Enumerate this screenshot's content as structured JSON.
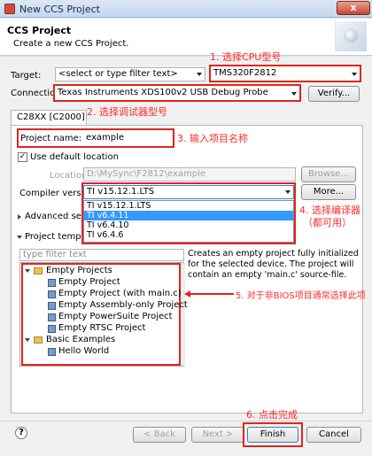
{
  "window": {
    "title": "New CCS Project",
    "close_label": "x"
  },
  "header": {
    "title": "CCS Project",
    "subtitle": "Create a new CCS Project."
  },
  "target": {
    "label": "Target:",
    "filter_value": "<select or type filter text>",
    "device_value": "TMS320F2812"
  },
  "connection": {
    "label": "Connection:",
    "value": "Texas Instruments XDS100v2 USB Debug Probe",
    "verify_label": "Verify..."
  },
  "tab": {
    "label": "C28XX [C2000]"
  },
  "project": {
    "name_label": "Project name:",
    "name_value": "example",
    "default_location_label": "Use default location",
    "location_label": "Location:",
    "location_value": "D:\\MySync\\F2812\\example",
    "browse_label": "Browse...",
    "compiler_label": "Compiler version:",
    "compiler_value": "TI v15.12.1.LTS",
    "more_label": "More...",
    "compiler_options": [
      "TI v15.12.1.LTS",
      "TI v6.4.11",
      "TI v6.4.10",
      "TI v6.4.6"
    ],
    "advanced_label": "Advanced setting",
    "templates_label": "Project template",
    "filter_placeholder": "type filter text"
  },
  "templates": {
    "empty_group": "Empty Projects",
    "empty_items": [
      "Empty Project",
      "Empty Project (with main.c)",
      "Empty Assembly-only Project",
      "Empty PowerSuite Project",
      "Empty RTSC Project"
    ],
    "basic_group": "Basic Examples",
    "basic_items": [
      "Hello World"
    ],
    "description": "Creates an empty project fully initialized for the selected device. The project will contain an empty 'main.c' source-file."
  },
  "footer": {
    "help_label": "?",
    "back_label": "< Back",
    "next_label": "Next >",
    "finish_label": "Finish",
    "cancel_label": "Cancel"
  },
  "annotations": {
    "a1": "1. 选择CPU型号",
    "a2": "2. 选择调试器型号",
    "a3": "3. 输入项目名称",
    "a4_line1": "4. 选择编译器",
    "a4_line2": "（都可用）",
    "a5": "5. 对于非BIOS项目通常选择此项",
    "a6": "6. 点击完成"
  }
}
